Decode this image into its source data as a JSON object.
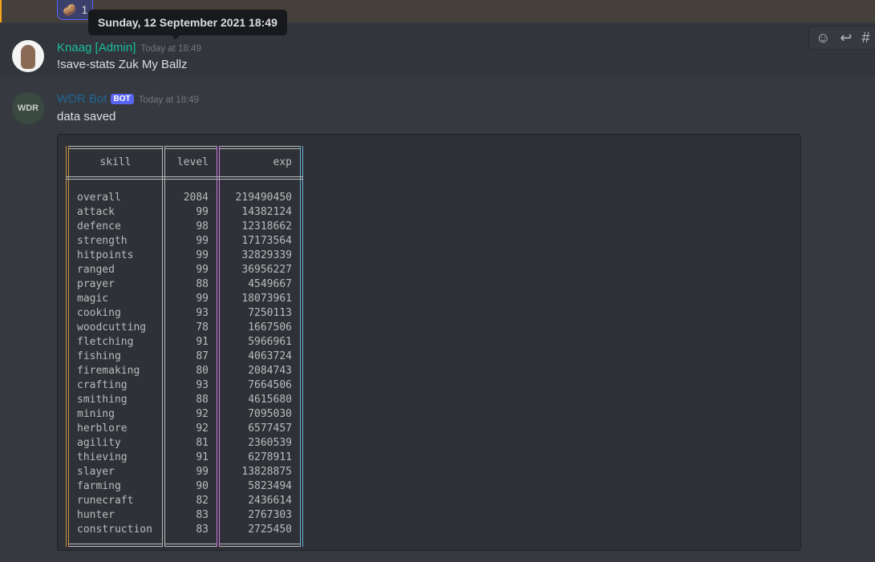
{
  "reaction": {
    "emoji": "🥔",
    "count": "1"
  },
  "tooltip": "Sunday, 12 September 2021 18:49",
  "messages": [
    {
      "author": "Knaag [Admin]",
      "author_color": "#1abc9c",
      "timestamp": "Today at 18:49",
      "text": "!save-stats Zuk My Ballz"
    },
    {
      "author": "WDR Bot",
      "author_color": "#206694",
      "badge": "BOT",
      "timestamp": "Today at 18:49",
      "text": "data saved"
    }
  ],
  "actions": [
    "add-reaction-icon",
    "reply-icon",
    "create-thread-icon"
  ],
  "table": {
    "headers": [
      "skill",
      "level",
      "exp"
    ],
    "rows": [
      [
        "overall",
        "2084",
        "219490450"
      ],
      [
        "attack",
        "99",
        "14382124"
      ],
      [
        "defence",
        "98",
        "12318662"
      ],
      [
        "strength",
        "99",
        "17173564"
      ],
      [
        "hitpoints",
        "99",
        "32829339"
      ],
      [
        "ranged",
        "99",
        "36956227"
      ],
      [
        "prayer",
        "88",
        "4549667"
      ],
      [
        "magic",
        "99",
        "18073961"
      ],
      [
        "cooking",
        "93",
        "7250113"
      ],
      [
        "woodcutting",
        "78",
        "1667506"
      ],
      [
        "fletching",
        "91",
        "5966961"
      ],
      [
        "fishing",
        "87",
        "4063724"
      ],
      [
        "firemaking",
        "80",
        "2084743"
      ],
      [
        "crafting",
        "93",
        "7664506"
      ],
      [
        "smithing",
        "88",
        "4615680"
      ],
      [
        "mining",
        "92",
        "7095030"
      ],
      [
        "herblore",
        "92",
        "6577457"
      ],
      [
        "agility",
        "81",
        "2360539"
      ],
      [
        "thieving",
        "91",
        "6278911"
      ],
      [
        "slayer",
        "99",
        "13828875"
      ],
      [
        "farming",
        "90",
        "5823494"
      ],
      [
        "runecraft",
        "82",
        "2436614"
      ],
      [
        "hunter",
        "83",
        "2767303"
      ],
      [
        "construction",
        "83",
        "2725450"
      ]
    ]
  }
}
